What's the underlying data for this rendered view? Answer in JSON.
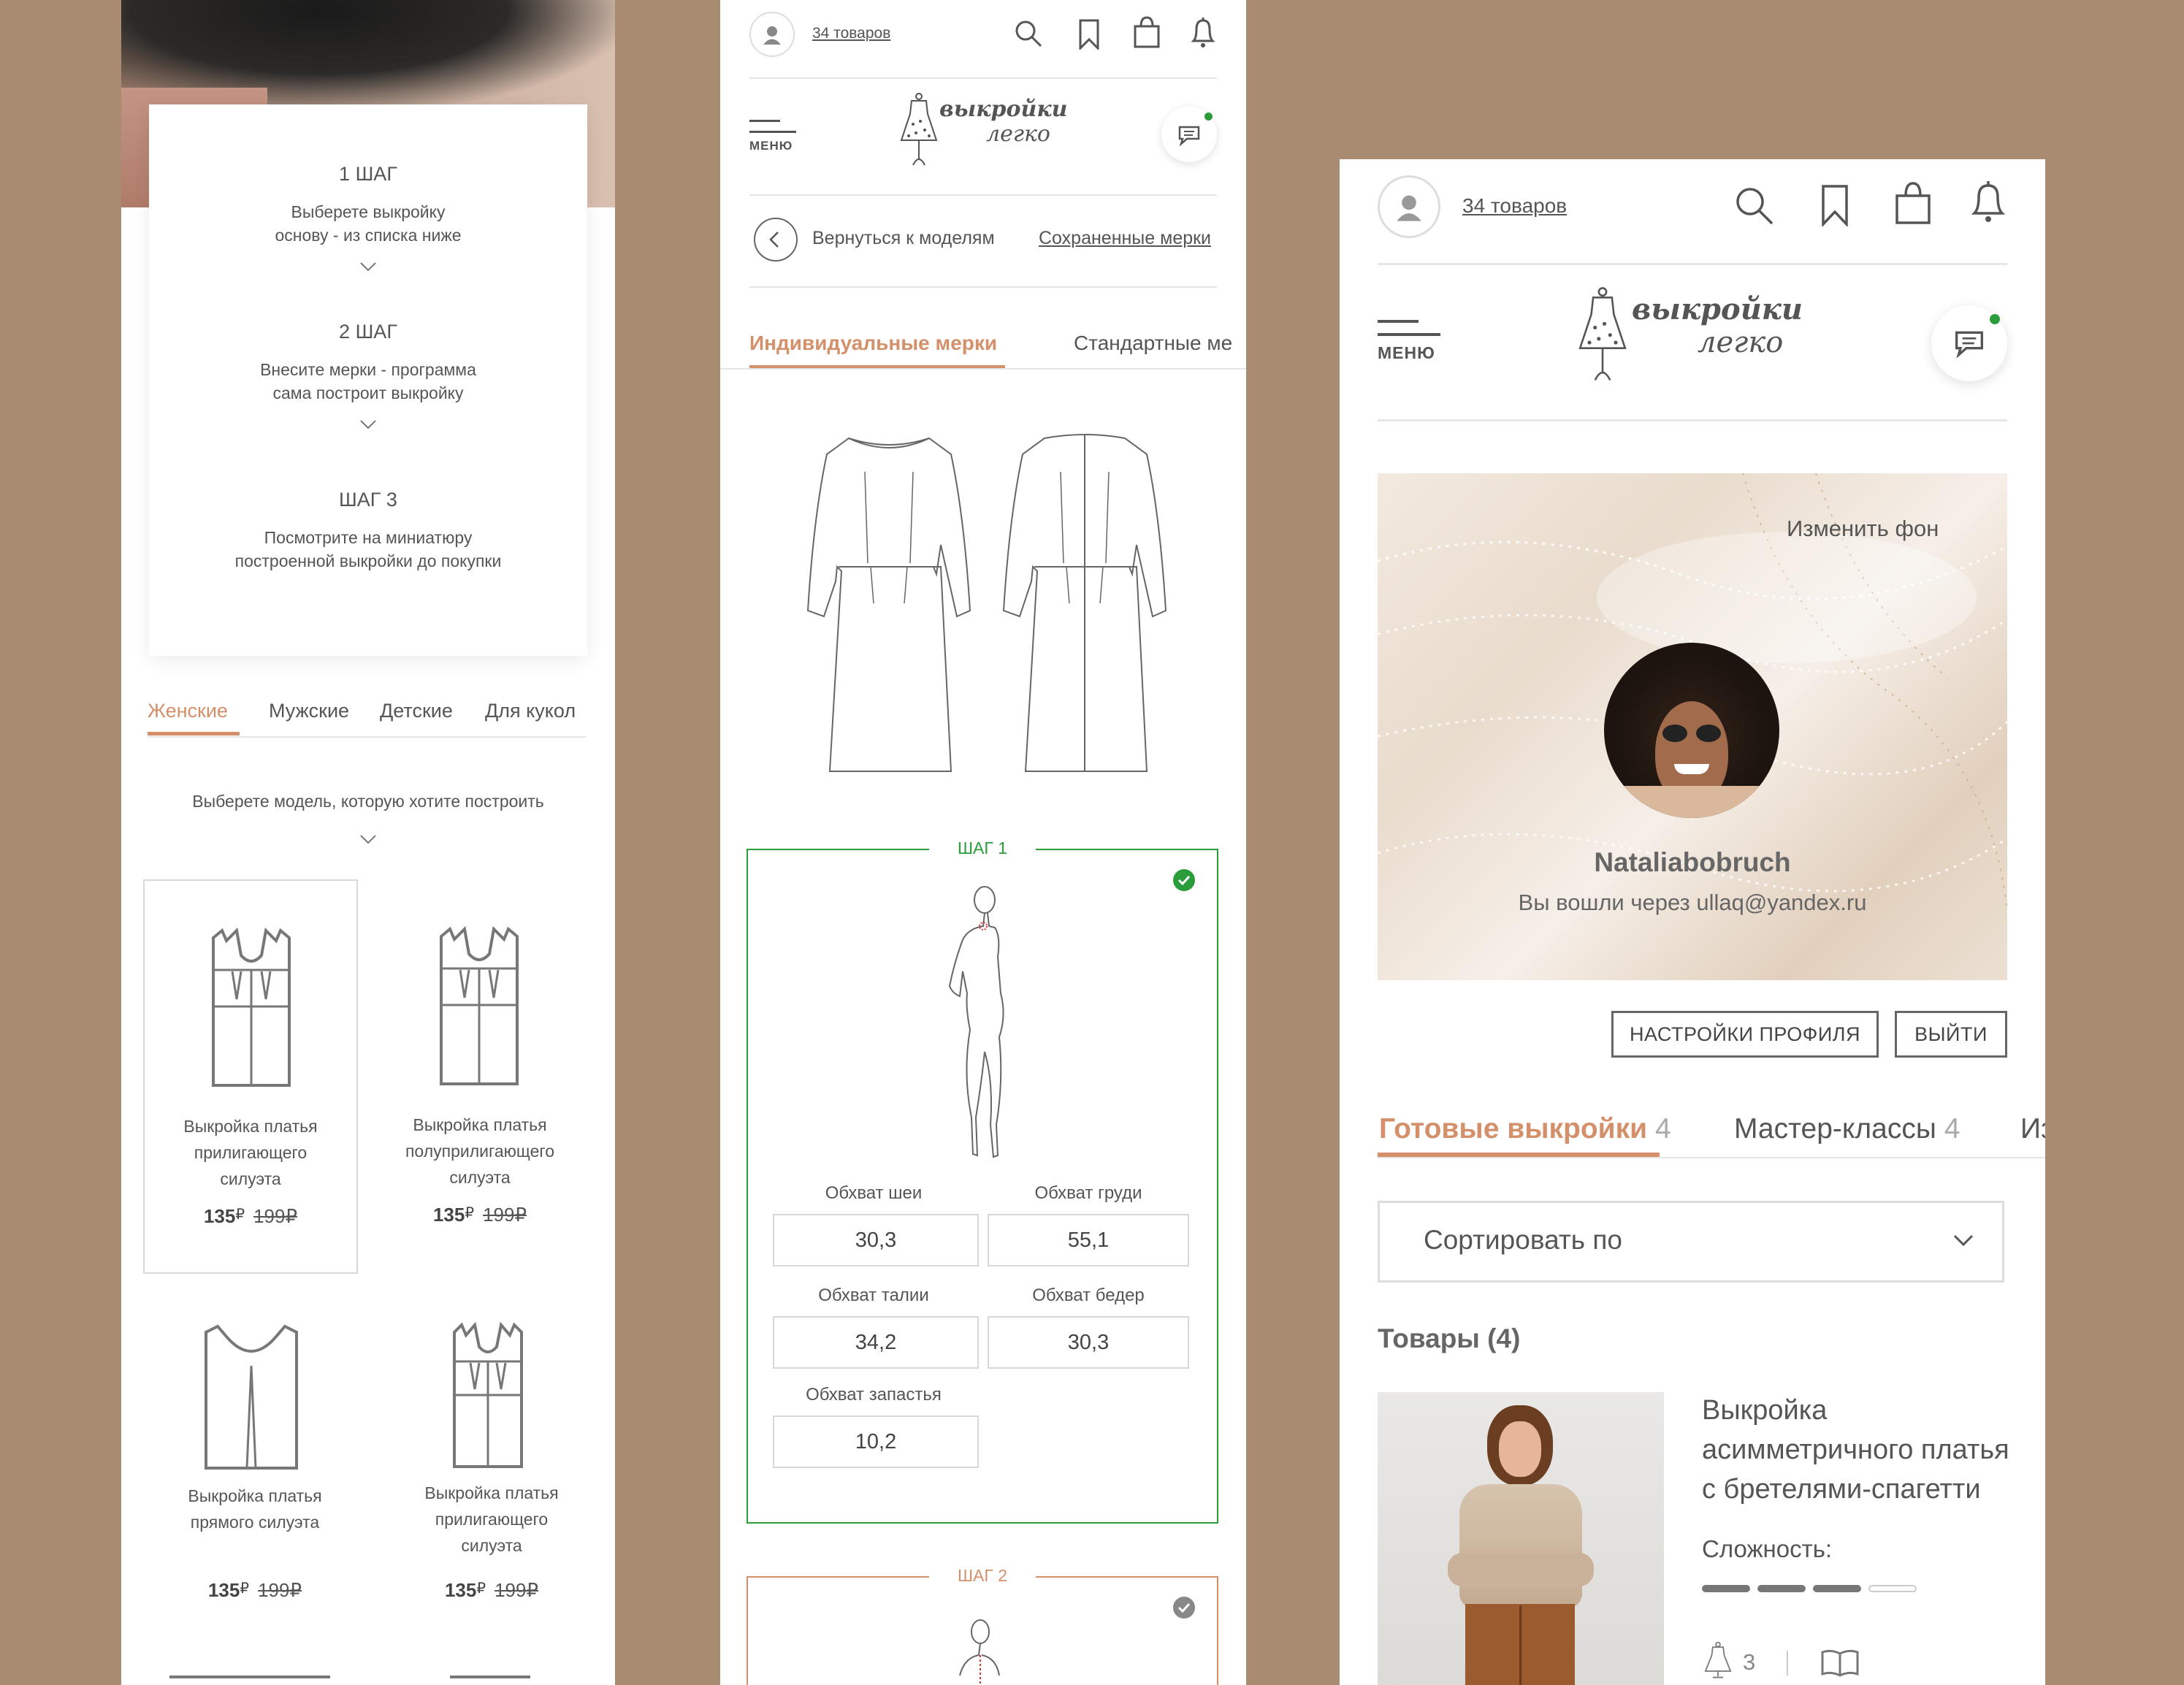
{
  "colors": {
    "background": "#a88b70",
    "accent": "#d4906a",
    "success": "#2a9c3a",
    "text": "#444444"
  },
  "left": {
    "steps": [
      {
        "title": "1 ШАГ",
        "text1": "Выберете выкройку",
        "text2": "основу - из списка ниже"
      },
      {
        "title": "2 ШАГ",
        "text1": "Внесите мерки - программа",
        "text2": "сама построит выкройку"
      },
      {
        "title": "ШАГ 3",
        "text1": "Посмотрите на миниатюру",
        "text2": "построенной выкройки до покупки"
      }
    ],
    "tabs": [
      "Женские",
      "Мужские",
      "Детские",
      "Для кукол"
    ],
    "choose_text": "Выберете модель, которую хотите построить",
    "products": [
      {
        "l1": "Выкройка платья",
        "l2": "прилигающего",
        "l3": "силуэта",
        "price": "135",
        "currency": "₽",
        "old": "199₽"
      },
      {
        "l1": "Выкройка платья",
        "l2": "полуприлигающего",
        "l3": "силуэта",
        "price": "135",
        "currency": "₽",
        "old": "199₽"
      },
      {
        "l1": "Выкройка платья",
        "l2": "прямого силуэта",
        "l3": "",
        "price": "135",
        "currency": "₽",
        "old": "199₽"
      },
      {
        "l1": "Выкройка платья",
        "l2": "прилигающего",
        "l3": "силуэта",
        "price": "135",
        "currency": "₽",
        "old": "199₽"
      }
    ]
  },
  "middle": {
    "header": {
      "cart_count": "34 товаров",
      "menu_label": "МЕНЮ",
      "logo_top": "выкройки",
      "logo_bottom": "легко"
    },
    "back_label": "Вернуться к моделям",
    "saved_label": "Сохраненные мерки",
    "tabs": [
      "Индивидуальные мерки",
      "Стандартные ме"
    ],
    "step1": {
      "title": "ШАГ 1",
      "fields": [
        {
          "label": "Обхват шеи",
          "value": "30,3"
        },
        {
          "label": "Обхват груди",
          "value": "55,1"
        },
        {
          "label": "Обхват талии",
          "value": "34,2"
        },
        {
          "label": "Обхват бедер",
          "value": "30,3"
        },
        {
          "label": "Обхват запастья",
          "value": "10,2"
        }
      ]
    },
    "step2": {
      "title": "ШАГ 2"
    }
  },
  "right": {
    "header": {
      "cart_count": "34 товаров",
      "menu_label": "МЕНЮ",
      "logo_top": "выкройки",
      "logo_bottom": "легко"
    },
    "change_bg": "Изменить фон",
    "username": "Nataliabobruch",
    "login_info": "Вы вошли через ullaq@yandex.ru",
    "settings_btn": "НАСТРОЙКИ ПРОФИЛЯ",
    "logout_btn": "ВЫЙТИ",
    "tabs": [
      {
        "label": "Готовые выкройки",
        "count": "4"
      },
      {
        "label": "Мастер-классы",
        "count": "4"
      },
      {
        "label": "Из",
        "count": ""
      }
    ],
    "sort_label": "Сортировать по",
    "goods_title": "Товары (4)",
    "product": {
      "l1": "Выкройка",
      "l2": "асимметричного платья",
      "l3": "с бретелями-спагетти",
      "difficulty_label": "Сложность:",
      "difficulty": 0.75,
      "count": "3"
    }
  }
}
